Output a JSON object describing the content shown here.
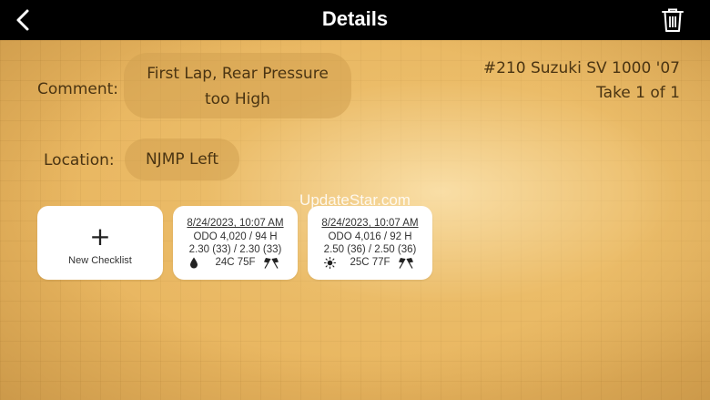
{
  "nav": {
    "title": "Details",
    "back_icon": "chevron-left-icon",
    "trash_icon": "trash-icon"
  },
  "comment": {
    "label": "Comment:",
    "value_line1": "First Lap, Rear Pressure",
    "value_line2": "too High"
  },
  "location": {
    "label": "Location:",
    "value": "NJMP Left"
  },
  "bike": {
    "name": "#210 Suzuki SV 1000 '07",
    "take": "Take 1 of 1"
  },
  "watermark": "UpdateStar.com",
  "new_checklist": {
    "plus": "+",
    "label": "New Checklist"
  },
  "sessions": [
    {
      "date": "8/24/2023, 10:07 AM",
      "odo": "ODO 4,020 / 94 H",
      "pressure": "2.30 (33) / 2.30 (33)",
      "weather_icon": "raindrop-icon",
      "temp": "24C 75F",
      "flag_icon": "checkered-flags-icon"
    },
    {
      "date": "8/24/2023, 10:07 AM",
      "odo": "ODO 4,016 / 92 H",
      "pressure": "2.50 (36) / 2.50 (36)",
      "weather_icon": "sun-icon",
      "temp": "25C 77F",
      "flag_icon": "checkered-flags-icon"
    }
  ],
  "colors": {
    "nav_bg": "#000000",
    "text_brown": "#4a3412",
    "card_bg": "#ffffff"
  }
}
